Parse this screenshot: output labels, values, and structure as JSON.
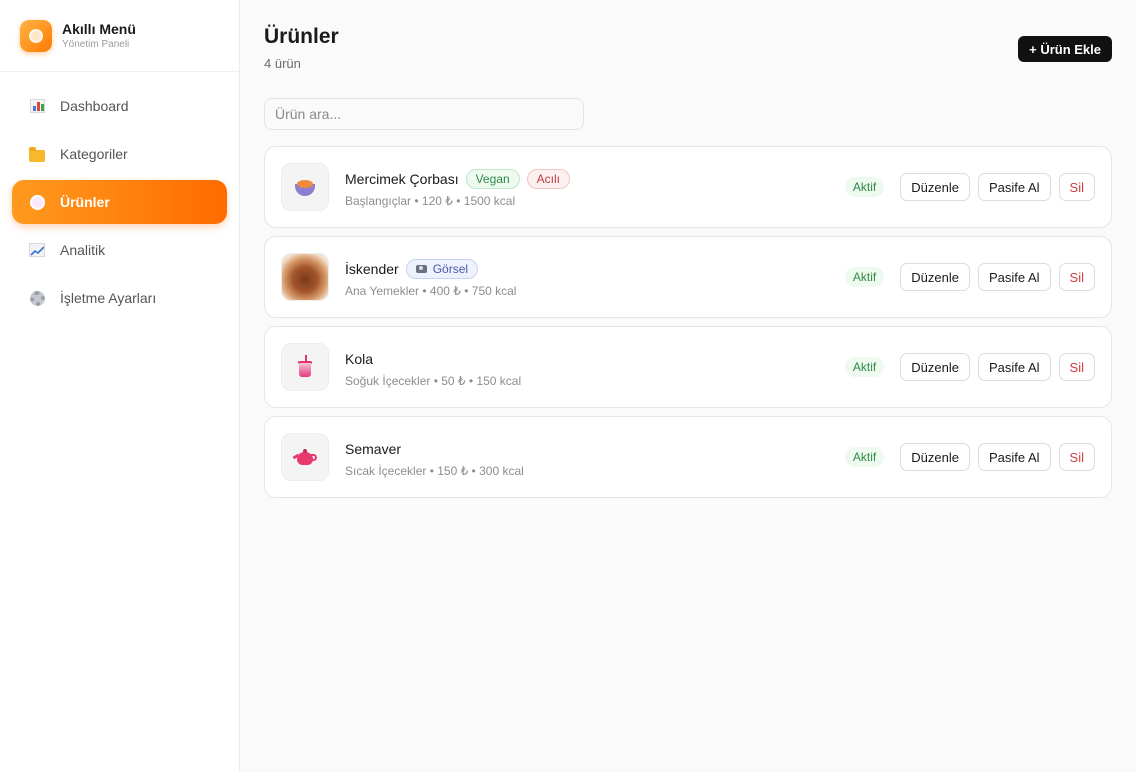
{
  "brand": {
    "title": "Akıllı Menü",
    "subtitle": "Yönetim Paneli"
  },
  "sidebar": {
    "items": [
      {
        "label": "Dashboard",
        "icon": "chart-icon",
        "active": false
      },
      {
        "label": "Kategoriler",
        "icon": "folder-icon",
        "active": false
      },
      {
        "label": "Ürünler",
        "icon": "plate-icon",
        "active": true
      },
      {
        "label": "Analitik",
        "icon": "trend-icon",
        "active": false
      },
      {
        "label": "İşletme Ayarları",
        "icon": "gear-icon",
        "active": false
      }
    ]
  },
  "header": {
    "title": "Ürünler",
    "count": "4 ürün",
    "add_label": "+ Ürün Ekle"
  },
  "search": {
    "placeholder": "Ürün ara..."
  },
  "products": [
    {
      "name": "Mercimek Çorbası",
      "badges": [
        "Vegan",
        "Acılı"
      ],
      "meta": "Başlangıçlar • 120 ₺ • 1500 kcal",
      "status": "Aktif",
      "thumb": "soup-icon"
    },
    {
      "name": "İskender",
      "badges": [
        "Görsel"
      ],
      "meta": "Ana Yemekler • 400 ₺ • 750 kcal",
      "status": "Aktif",
      "thumb": "iskender-photo"
    },
    {
      "name": "Kola",
      "badges": [],
      "meta": "Soğuk İçecekler • 50 ₺ • 150 kcal",
      "status": "Aktif",
      "thumb": "cup-icon"
    },
    {
      "name": "Semaver",
      "badges": [],
      "meta": "Sıcak İçecekler • 150 ₺ • 300 kcal",
      "status": "Aktif",
      "thumb": "teapot-icon"
    }
  ],
  "actions": {
    "edit": "Düzenle",
    "deactivate": "Pasife Al",
    "delete": "Sil"
  },
  "colors": {
    "accent": "#ff7a00",
    "active_status": "#2e8a45",
    "delete": "#d23c3c"
  }
}
